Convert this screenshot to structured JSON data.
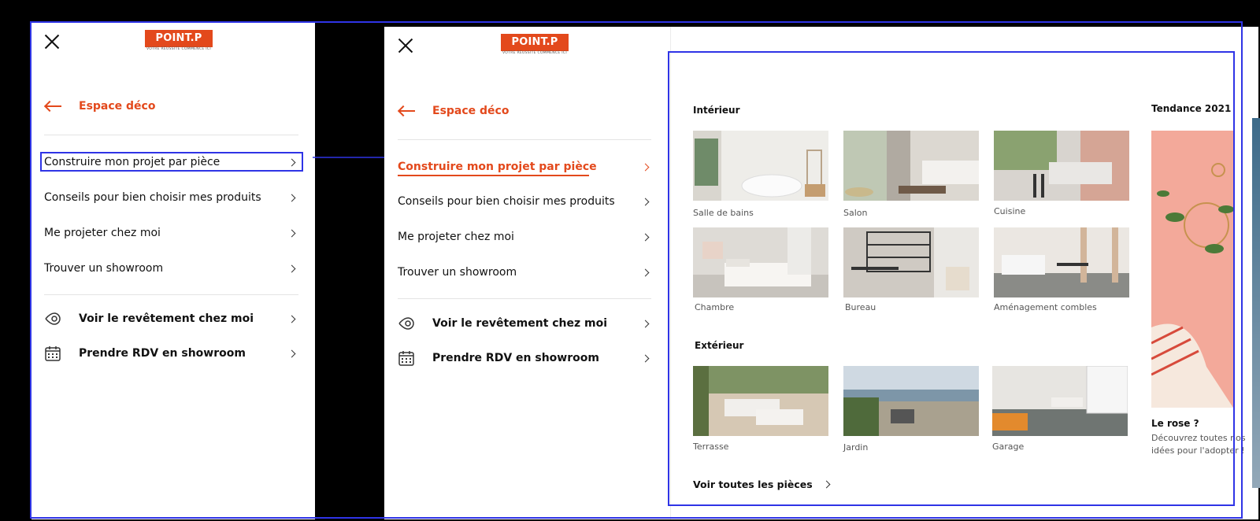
{
  "brand": {
    "name": "POINT.P",
    "tagline": "VOTRE RÉUSSITE COMMENCE ICI",
    "color": "#e3491c"
  },
  "nav": {
    "back_label": "Espace déco",
    "items": [
      {
        "label": "Construire mon projet par pièce"
      },
      {
        "label": "Conseils pour bien choisir mes produits"
      },
      {
        "label": "Me projeter chez moi"
      },
      {
        "label": "Trouver un showroom"
      }
    ],
    "actions": [
      {
        "label": "Voir le revêtement chez moi",
        "icon": "view-icon"
      },
      {
        "label": "Prendre RDV en showroom",
        "icon": "calendar-icon"
      }
    ]
  },
  "content": {
    "interieur_title": "Intérieur",
    "interieur_rooms": [
      {
        "label": "Salle de bains"
      },
      {
        "label": "Salon"
      },
      {
        "label": "Cuisine"
      },
      {
        "label": "Chambre"
      },
      {
        "label": "Bureau"
      },
      {
        "label": "Aménagement combles"
      }
    ],
    "exterieur_title": "Extérieur",
    "exterieur_rooms": [
      {
        "label": "Terrasse"
      },
      {
        "label": "Jardin"
      },
      {
        "label": "Garage"
      }
    ],
    "see_all_label": "Voir toutes les pièces",
    "trend": {
      "title": "Tendance 2021",
      "card_title": "Le rose ?",
      "card_desc": "Découvrez toutes nos idées pour l'adopter !"
    }
  },
  "annotation_color": "#2f34e6"
}
